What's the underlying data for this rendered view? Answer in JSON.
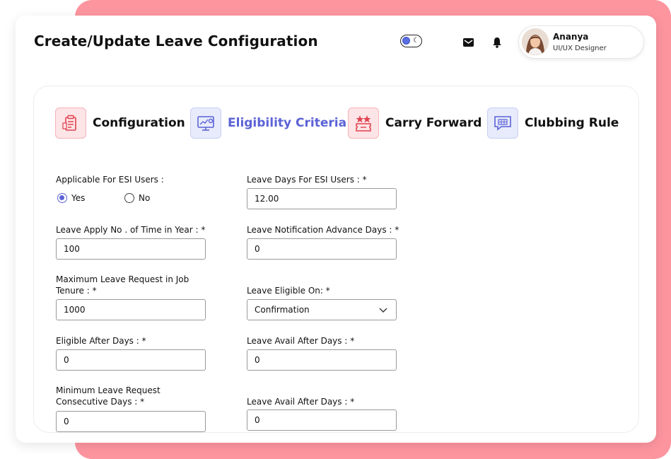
{
  "header": {
    "title": "Create/Update Leave Configuration",
    "user_name": "Ananya",
    "user_role": "UI/UX Designer",
    "theme_toggle_icon": "moon-icon",
    "mail_icon": "mail-icon",
    "bell_icon": "bell-icon"
  },
  "tabs": [
    {
      "label": "Configuration",
      "icon": "clipboard-list-icon",
      "active": false
    },
    {
      "label": "Eligibility Criteria",
      "icon": "monitor-chart-icon",
      "active": true
    },
    {
      "label": "Carry Forward",
      "icon": "award-ticket-icon",
      "active": false
    },
    {
      "label": "Clubbing Rule",
      "icon": "calendar-chat-icon",
      "active": false
    }
  ],
  "form": {
    "esi_users_label": "Applicable For ESI Users :",
    "esi_yes": "Yes",
    "esi_no": "No",
    "esi_selected": "Yes",
    "leave_days_esi_label": "Leave Days For ESI Users : *",
    "leave_days_esi_value": "12.00",
    "apply_times_label": "Leave Apply No . of Time in Year : *",
    "apply_times_value": "100",
    "notification_days_label": "Leave Notification Advance Days : *",
    "notification_days_value": "0",
    "max_request_label_1": "Maximum Leave Request in Job",
    "max_request_label_2": "Tenure : *",
    "max_request_value": "1000",
    "eligible_on_label": "Leave Eligible On: *",
    "eligible_on_value": "Confirmation",
    "eligible_after_label": "Eligible After Days : *",
    "eligible_after_value": "0",
    "avail_after_label": "Leave Avail After Days : *",
    "avail_after_value": "0",
    "min_consecutive_label_1": "Minimum Leave Request",
    "min_consecutive_label_2": "Consecutive Days : *",
    "min_consecutive_value": "0",
    "avail_after_label_2": "Leave Avail After Days : *",
    "avail_after_value_2": "0"
  },
  "colors": {
    "accent": "#5b63d6",
    "pink_background": "#fd959f"
  }
}
